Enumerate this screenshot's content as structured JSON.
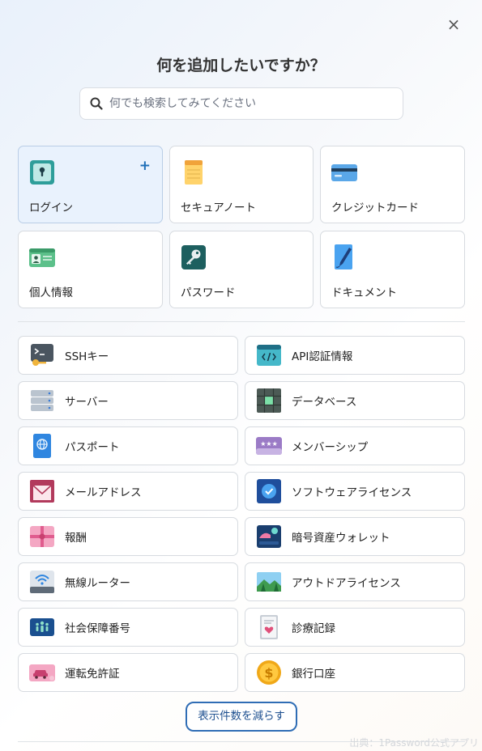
{
  "title": "何を追加したいですか？",
  "close_label": "×",
  "search": {
    "placeholder": "何でも検索してみてください"
  },
  "primary_items": [
    {
      "label": "ログイン",
      "icon": "login-lock-icon",
      "selected": true,
      "badge": "+"
    },
    {
      "label": "セキュアノート",
      "icon": "secure-note-icon"
    },
    {
      "label": "クレジットカード",
      "icon": "credit-card-icon"
    },
    {
      "label": "個人情報",
      "icon": "identity-card-icon"
    },
    {
      "label": "パスワード",
      "icon": "key-icon"
    },
    {
      "label": "ドキュメント",
      "icon": "document-icon"
    }
  ],
  "secondary_items": [
    {
      "label": "SSHキー",
      "icon": "ssh-key-icon"
    },
    {
      "label": "API認証情報",
      "icon": "api-credential-icon"
    },
    {
      "label": "サーバー",
      "icon": "server-icon"
    },
    {
      "label": "データベース",
      "icon": "database-icon"
    },
    {
      "label": "パスポート",
      "icon": "passport-icon"
    },
    {
      "label": "メンバーシップ",
      "icon": "membership-icon"
    },
    {
      "label": "メールアドレス",
      "icon": "email-icon"
    },
    {
      "label": "ソフトウェアライセンス",
      "icon": "software-license-icon"
    },
    {
      "label": "報酬",
      "icon": "reward-gift-icon"
    },
    {
      "label": "暗号資産ウォレット",
      "icon": "crypto-wallet-icon"
    },
    {
      "label": "無線ルーター",
      "icon": "wireless-router-icon"
    },
    {
      "label": "アウトドアライセンス",
      "icon": "outdoor-license-icon"
    },
    {
      "label": "社会保障番号",
      "icon": "social-security-icon"
    },
    {
      "label": "診療記録",
      "icon": "medical-record-icon"
    },
    {
      "label": "運転免許証",
      "icon": "driver-license-icon"
    },
    {
      "label": "銀行口座",
      "icon": "bank-account-icon"
    }
  ],
  "toggle_button": "表示件数を減らす",
  "credit": "出典：1Password公式アプリ",
  "colors": {
    "accent": "#2f6db5",
    "selected_bg": "#e9f2fd"
  }
}
